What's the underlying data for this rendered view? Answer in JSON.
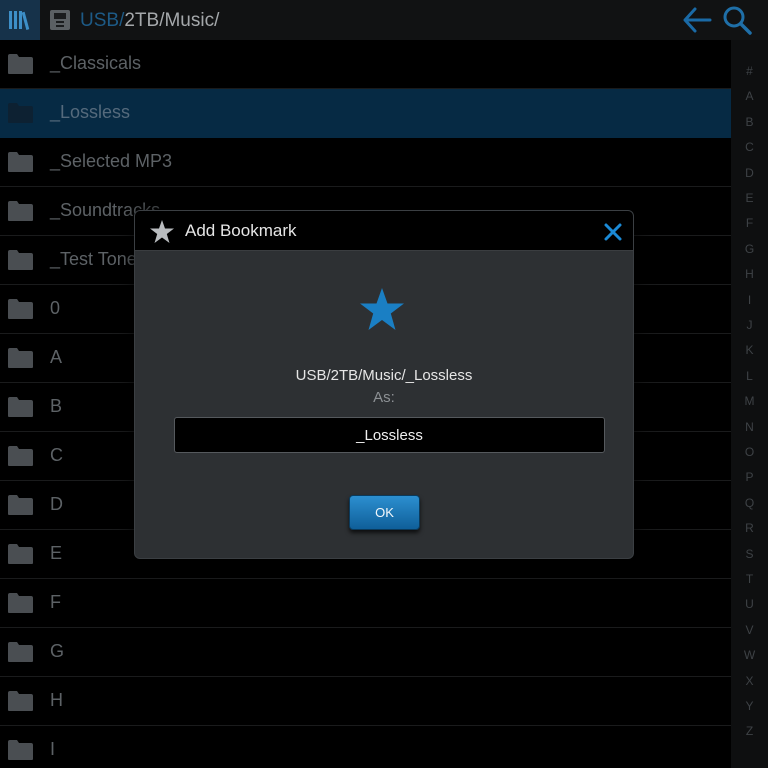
{
  "topbar": {
    "library_icon": "library-icon",
    "usb_icon": "usb-drive-icon",
    "path_root": "USB/",
    "path_rest": "2TB/Music/",
    "back_icon": "back-arrow-icon",
    "search_icon": "search-icon"
  },
  "list": {
    "items": [
      {
        "label": "_Classicals",
        "selected": false
      },
      {
        "label": "_Lossless",
        "selected": true
      },
      {
        "label": "_Selected MP3",
        "selected": false
      },
      {
        "label": "_Soundtracks",
        "selected": false
      },
      {
        "label": "_Test Tones",
        "selected": false
      },
      {
        "label": "0",
        "selected": false
      },
      {
        "label": "A",
        "selected": false
      },
      {
        "label": "B",
        "selected": false
      },
      {
        "label": "C",
        "selected": false
      },
      {
        "label": "D",
        "selected": false
      },
      {
        "label": "E",
        "selected": false
      },
      {
        "label": "F",
        "selected": false
      },
      {
        "label": "G",
        "selected": false
      },
      {
        "label": "H",
        "selected": false
      },
      {
        "label": "I",
        "selected": false
      }
    ]
  },
  "index": {
    "letters": [
      "#",
      "A",
      "B",
      "C",
      "D",
      "E",
      "F",
      "G",
      "H",
      "I",
      "J",
      "K",
      "L",
      "M",
      "N",
      "O",
      "P",
      "Q",
      "R",
      "S",
      "T",
      "U",
      "V",
      "W",
      "X",
      "Y",
      "Z"
    ]
  },
  "dialog": {
    "title": "Add Bookmark",
    "path": "USB/2TB/Music/_Lossless",
    "as_label": "As:",
    "name_value": "_Lossless",
    "ok_label": "OK"
  },
  "colors": {
    "accent": "#1a7fc4",
    "selected_row": "#062a44",
    "dialog_bg": "#2d3033"
  }
}
